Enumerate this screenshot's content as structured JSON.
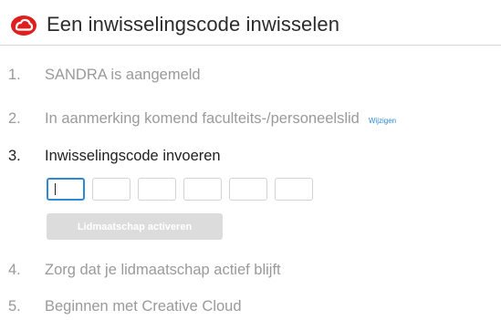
{
  "header": {
    "title": "Een inwisselingscode inwisselen",
    "logo_icon": "creative-cloud-logo-icon",
    "logo_color": "#e01e1e"
  },
  "steps": [
    {
      "number": "1.",
      "text": "SANDRA is aangemeld",
      "state": "done"
    },
    {
      "number": "2.",
      "text": "In aanmerking komend faculteits-/personeelslid",
      "link": "Wijzigen",
      "state": "done"
    },
    {
      "number": "3.",
      "text": "Inwisselingscode invoeren",
      "state": "active"
    },
    {
      "number": "4.",
      "text": "Zorg dat je lidmaatschap actief blijft",
      "state": "pending"
    },
    {
      "number": "5.",
      "text": "Beginnen met Creative Cloud",
      "state": "pending"
    }
  ],
  "code_inputs": [
    "",
    "",
    "",
    "",
    "",
    ""
  ],
  "activate_button": {
    "label": "Lidmaatschap activeren",
    "disabled": true
  },
  "colors": {
    "accent": "#2d8ad8",
    "muted_text": "#9a9a9a",
    "active_text": "#222222",
    "disabled_button": "#dcdcdc"
  }
}
